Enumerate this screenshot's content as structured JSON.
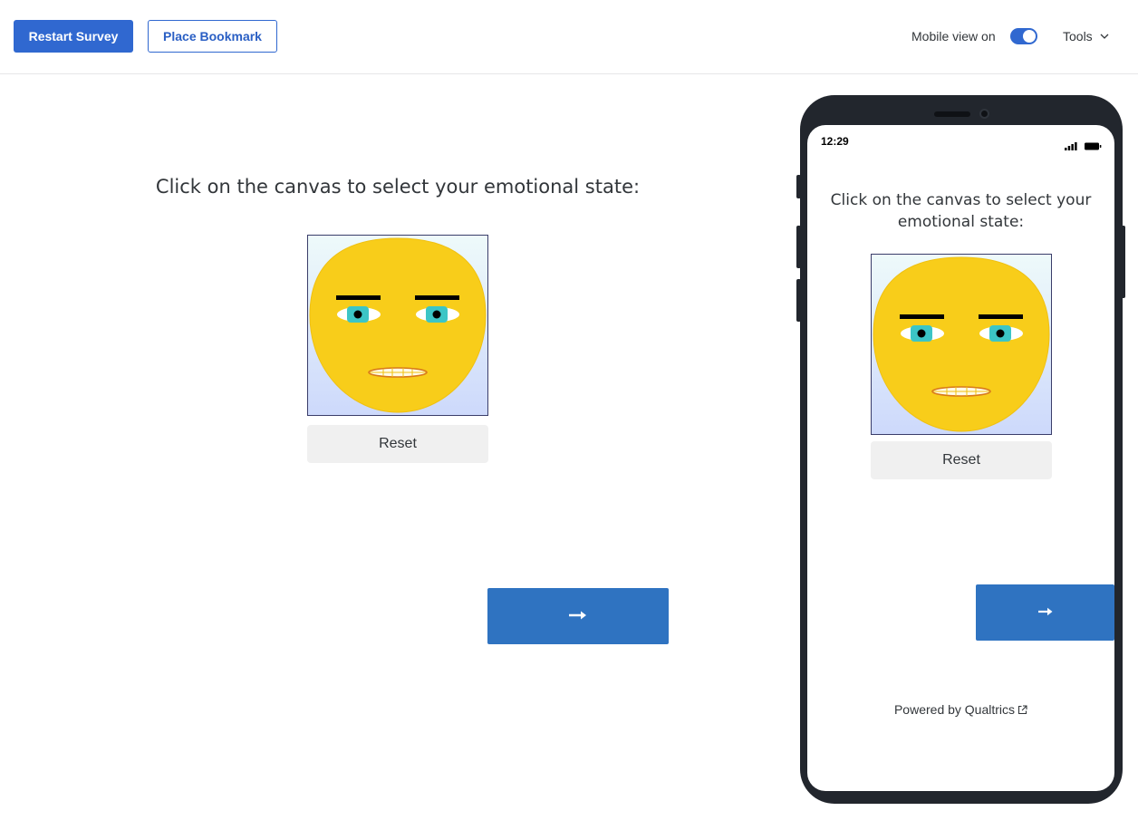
{
  "toolbar": {
    "restart_label": "Restart Survey",
    "bookmark_label": "Place Bookmark",
    "mobile_view_label": "Mobile view on",
    "mobile_view_on": true,
    "tools_label": "Tools"
  },
  "survey": {
    "question": "Click on the canvas to select your emotional state:",
    "reset_label": "Reset",
    "next_label": "→"
  },
  "phone": {
    "time": "12:29",
    "question": "Click on the canvas to select your emotional state:",
    "reset_label": "Reset",
    "next_label": "→",
    "powered_by": "Powered by Qualtrics"
  },
  "icons": {
    "tools_chevron": "chevron-down-icon",
    "next_arrow": "arrow-right-icon",
    "signal": "signal-icon",
    "battery": "battery-icon",
    "external_link": "external-link-icon"
  },
  "colors": {
    "accent": "#3068d0",
    "next_button": "#2f73c1",
    "face": "#f8cd1a",
    "iris": "#3cc5c6",
    "phone_frame": "#22262d"
  }
}
